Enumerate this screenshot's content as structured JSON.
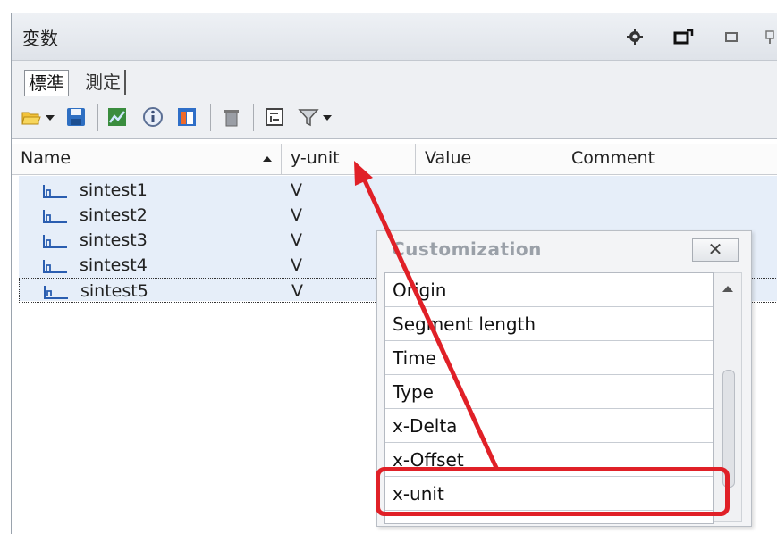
{
  "panel": {
    "title": "変数",
    "tabs": [
      {
        "label": "標準",
        "active": true
      },
      {
        "label": "測定",
        "active": false
      }
    ]
  },
  "toolbar": {
    "icons": [
      "open-folder-icon",
      "save-icon",
      "chart-icon",
      "info-icon",
      "window-icon",
      "delete-icon",
      "layout-icon",
      "filter-icon"
    ]
  },
  "table": {
    "columns": [
      "Name",
      "y-unit",
      "Value",
      "Comment"
    ],
    "sort": {
      "column": "Name",
      "direction": "asc"
    },
    "rows": [
      {
        "name": "sintest1",
        "y_unit": "V"
      },
      {
        "name": "sintest2",
        "y_unit": "V"
      },
      {
        "name": "sintest3",
        "y_unit": "V"
      },
      {
        "name": "sintest4",
        "y_unit": "V"
      },
      {
        "name": "sintest5",
        "y_unit": "V"
      }
    ]
  },
  "customization": {
    "title": "Customization",
    "close_label": "✕",
    "items": [
      "Origin",
      "Segment length",
      "Time",
      "Type",
      "x-Delta",
      "x-Offset",
      "x-unit"
    ],
    "highlighted_item": "x-unit"
  },
  "colors": {
    "annotation": "#e02027",
    "row_highlight": "#e6eef9"
  }
}
